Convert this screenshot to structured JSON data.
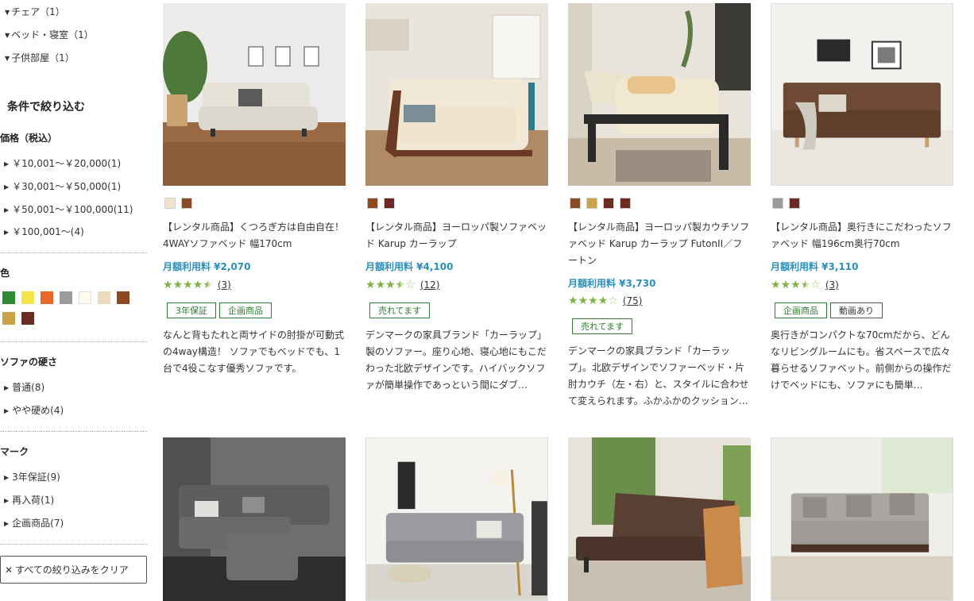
{
  "colors": {
    "price": "#2a8fbd",
    "star": "#7cb342",
    "badge_green": "#2e7d32"
  },
  "sidebar": {
    "categories": [
      {
        "label": "チェア（1）"
      },
      {
        "label": "ベッド・寝室（1）"
      },
      {
        "label": "子供部屋（1）"
      }
    ],
    "filter_title": "条件で絞り込む",
    "price_section": {
      "title": "価格（税込）",
      "options": [
        {
          "label": "￥10,001～￥20,000(1)"
        },
        {
          "label": "￥30,001～￥50,000(1)"
        },
        {
          "label": "￥50,001～￥100,000(11)"
        },
        {
          "label": "￥100,001～(4)"
        }
      ]
    },
    "color_section": {
      "title": "色",
      "swatches": [
        "#2e8b34",
        "#f5e34a",
        "#e8672a",
        "#9b9b9b",
        "#fdfaf0",
        "#ecd9bf",
        "#8b4a22",
        "#c9a24a",
        "#6b2a22"
      ]
    },
    "hardness_section": {
      "title": "ソファの硬さ",
      "options": [
        {
          "label": "普通(8)"
        },
        {
          "label": "やや硬め(4)"
        }
      ]
    },
    "mark_section": {
      "title": "マーク",
      "options": [
        {
          "label": "3年保証(9)"
        },
        {
          "label": "再入荷(1)"
        },
        {
          "label": "企画商品(7)"
        }
      ]
    },
    "clear_label": "すべての絞り込みをクリア"
  },
  "products": [
    {
      "image": "cream-sofa-bed-photo",
      "colors": [
        "#f0e2cb",
        "#8b4a22"
      ],
      "name": "【レンタル商品】くつろぎ方は自由自在！4WAYソファベッド 幅170cm",
      "price": "月額利用料 ¥2,070",
      "rating": 4.5,
      "stars": "★★★★★",
      "reviews": "(3)",
      "badges": [
        "3年保証",
        "企画商品"
      ],
      "desc": "なんと背もたれと両サイドの肘掛が可動式の4way構造！ ソファでもベッドでも、1台で4役こなす優秀ソファです。"
    },
    {
      "image": "karup-sofa-bed-photo",
      "colors": [
        "#8b4a22",
        "#6b2a22"
      ],
      "name": "【レンタル商品】ヨーロッパ製ソファベッド Karup カーラップ",
      "price": "月額利用料 ¥4,100",
      "rating": 3.5,
      "stars": "★★★☆☆",
      "reviews": "(12)",
      "badges": [
        "売れてます"
      ],
      "desc": "デンマークの家具ブランド「カーラップ」製のソファー。座り心地、寝心地にもこだわった北欧デザインです。ハイバックソファが簡単操作であっという間にダブ…"
    },
    {
      "image": "karup-couch-photo",
      "colors": [
        "#8b4a22",
        "#c9a24a",
        "#6b2a22",
        "#6b2a22"
      ],
      "name": "【レンタル商品】ヨーロッパ製カウチソファベッド Karup カーラップ FutonII／フートン",
      "price": "月額利用料 ¥3,730",
      "rating": 4,
      "stars": "★★★★☆",
      "reviews": "(75)",
      "badges": [
        "売れてます"
      ],
      "desc": "デンマークの家具ブランド「カーラップ」。北欧デザインでソファーベッド・片肘カウチ（左・右）と、スタイルに合わせて変えられます。ふかふかのクッション…"
    },
    {
      "image": "brown-sofa-bed-photo",
      "colors": [
        "#9b9b9b",
        "#6b2a22"
      ],
      "name": "【レンタル商品】奥行きにこだわったソファベッド 幅196cm奥行70cm",
      "price": "月額利用料 ¥3,110",
      "rating": 3.5,
      "stars": "★★★☆☆",
      "reviews": "(3)",
      "badges": [
        "企画商品",
        "動画あり"
      ],
      "desc": "奥行きがコンパクトな70cmだから、どんなリビングルームにも。省スペースで広々暮らせるソファベット。前側からの操作だけでベッドにも、ソファにも簡単…"
    },
    {
      "image": "gray-corner-sofa-photo"
    },
    {
      "image": "gray-tufted-sofa-photo"
    },
    {
      "image": "brown-wood-sofa-photo"
    },
    {
      "image": "gray-fabric-sofa-photo"
    }
  ]
}
